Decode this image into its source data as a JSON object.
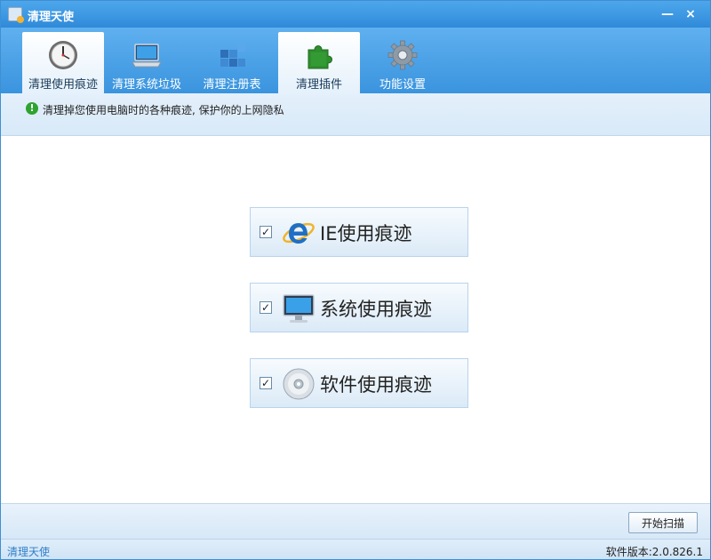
{
  "window": {
    "title": "清理天使"
  },
  "titlebar": {
    "minimize": "—",
    "close": "×"
  },
  "tabs": [
    {
      "label": "清理使用痕迹",
      "icon": "clock-icon",
      "active": true
    },
    {
      "label": "清理系统垃圾",
      "icon": "laptop-icon",
      "active": false
    },
    {
      "label": "清理注册表",
      "icon": "registry-blocks-icon",
      "active": false
    },
    {
      "label": "清理插件",
      "icon": "puzzle-icon",
      "active": true
    },
    {
      "label": "功能设置",
      "icon": "gear-icon",
      "active": false
    }
  ],
  "info": {
    "icon": "!",
    "text": "清理掉您使用电脑时的各种痕迹, 保护你的上网隐私"
  },
  "options": [
    {
      "label": "IE使用痕迹",
      "checked": true,
      "icon": "ie-icon"
    },
    {
      "label": "系统使用痕迹",
      "checked": true,
      "icon": "monitor-icon"
    },
    {
      "label": "软件使用痕迹",
      "checked": true,
      "icon": "disc-icon"
    }
  ],
  "check_mark": "✓",
  "actions": {
    "scan_label": "开始扫描"
  },
  "status": {
    "app_name": "清理天使",
    "version": "软件版本:2.0.826.1"
  },
  "colors": {
    "titlebar": "#2f8ad9",
    "tabstrip": "#3a94de",
    "infobar": "#e4f0fb",
    "accent": "#2f7fc8",
    "info_icon": "#2fa32f"
  }
}
